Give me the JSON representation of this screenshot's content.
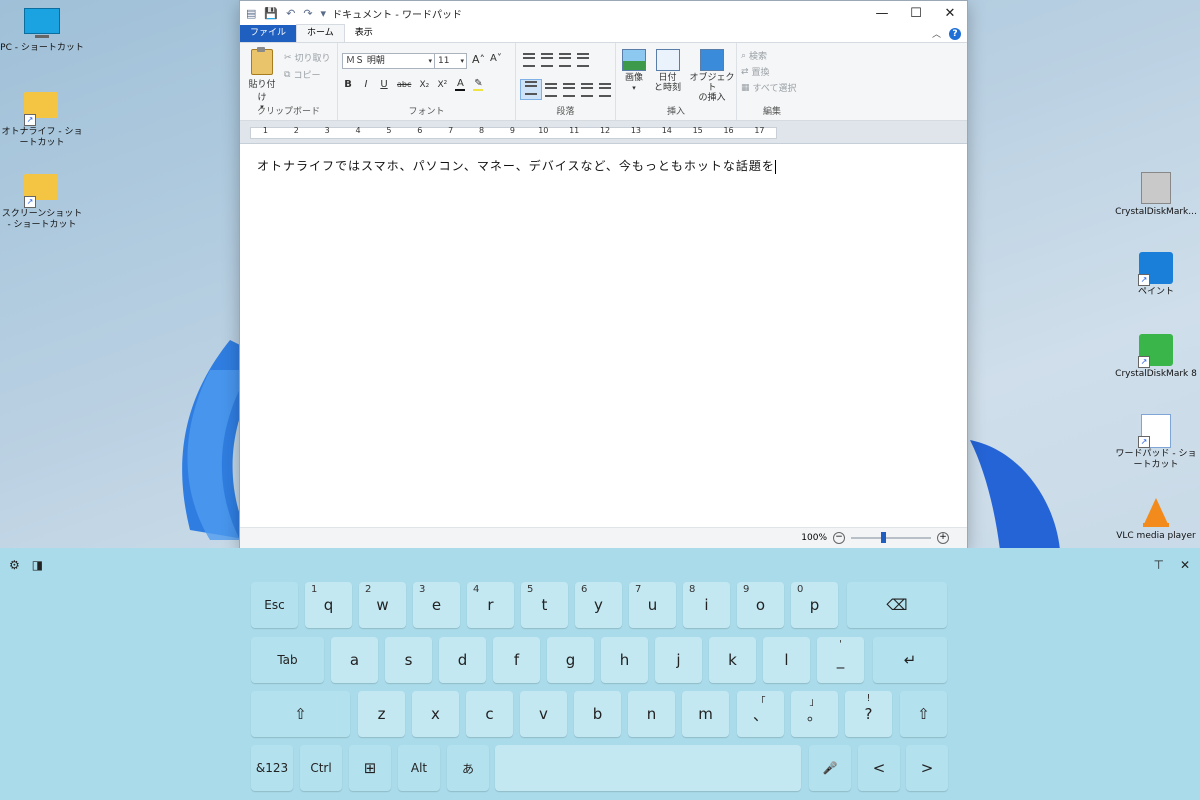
{
  "desktop": {
    "icons_left": [
      {
        "label": "PC - ショートカット",
        "icon": "monitor-icon"
      },
      {
        "label": "オトナライフ - ショートカット",
        "icon": "folder-icon"
      },
      {
        "label": "スクリーンショット - ショートカット",
        "icon": "folder-icon"
      }
    ],
    "icons_right": [
      {
        "label": "CrystalDiskMark...",
        "icon": "app-icon"
      },
      {
        "label": "ペイント",
        "icon": "paint-icon"
      },
      {
        "label": "CrystalDiskMark 8",
        "icon": "disk-icon"
      },
      {
        "label": "ワードパッド - ショートカット",
        "icon": "wordpad-icon"
      },
      {
        "label": "VLC media player",
        "icon": "vlc-icon"
      }
    ]
  },
  "window": {
    "title": "ドキュメント - ワードパッド",
    "controls": {
      "minimize": "—",
      "maximize": "☐",
      "close": "✕"
    },
    "tabs": [
      "ファイル",
      "ホーム",
      "表示"
    ],
    "clipboard": {
      "paste": "貼り付け",
      "cut": "切り取り",
      "copy": "コピー",
      "label": "クリップボード"
    },
    "font": {
      "name": "ＭＳ 明朝",
      "size": "11",
      "label": "フォント",
      "buttons": [
        "B",
        "I",
        "U",
        "abc",
        "X₂",
        "X²",
        "A",
        "✎"
      ]
    },
    "paragraph": {
      "label": "段落"
    },
    "insert": {
      "picture": "画像",
      "datetime_1": "日付",
      "datetime_2": "と時刻",
      "object_1": "オブジェクト",
      "object_2": "の挿入",
      "label": "挿入"
    },
    "edit": {
      "find": "検索",
      "replace": "置換",
      "select_all": "すべて選択",
      "label": "編集"
    },
    "ruler_numbers": [
      "1",
      "2",
      "3",
      "4",
      "5",
      "6",
      "7",
      "8",
      "9",
      "10",
      "11",
      "12",
      "13",
      "14",
      "15",
      "16",
      "17"
    ],
    "document_text": "オトナライフではスマホ、パソコン、マネー、デバイスなど、今もっともホットな話題を",
    "zoom": "100%"
  },
  "keyboard": {
    "row1": [
      {
        "main": "Esc"
      },
      {
        "main": "q",
        "sub": "1"
      },
      {
        "main": "w",
        "sub": "2"
      },
      {
        "main": "e",
        "sub": "3"
      },
      {
        "main": "r",
        "sub": "4"
      },
      {
        "main": "t",
        "sub": "5"
      },
      {
        "main": "y",
        "sub": "6"
      },
      {
        "main": "u",
        "sub": "7"
      },
      {
        "main": "i",
        "sub": "8"
      },
      {
        "main": "o",
        "sub": "9"
      },
      {
        "main": "p",
        "sub": "0"
      },
      {
        "main": "⌫"
      }
    ],
    "row2": [
      {
        "main": "Tab"
      },
      {
        "main": "a"
      },
      {
        "main": "s"
      },
      {
        "main": "d"
      },
      {
        "main": "f"
      },
      {
        "main": "g"
      },
      {
        "main": "h"
      },
      {
        "main": "j"
      },
      {
        "main": "k"
      },
      {
        "main": "l"
      },
      {
        "main": "_",
        "sub": "'"
      },
      {
        "main": "↵"
      }
    ],
    "row3": [
      {
        "main": "⇧"
      },
      {
        "main": "z"
      },
      {
        "main": "x"
      },
      {
        "main": "c"
      },
      {
        "main": "v"
      },
      {
        "main": "b"
      },
      {
        "main": "n"
      },
      {
        "main": "m"
      },
      {
        "main": "、",
        "sub": "「"
      },
      {
        "main": "。",
        "sub": "」"
      },
      {
        "main": "?",
        "sub": "!"
      },
      {
        "main": "⇧"
      }
    ],
    "row4": [
      {
        "main": "&123"
      },
      {
        "main": "Ctrl"
      },
      {
        "main": "⊞"
      },
      {
        "main": "Alt"
      },
      {
        "main": "あ"
      },
      {
        "main": ""
      },
      {
        "main": "🎤"
      },
      {
        "main": "<"
      },
      {
        "main": ">"
      }
    ]
  }
}
